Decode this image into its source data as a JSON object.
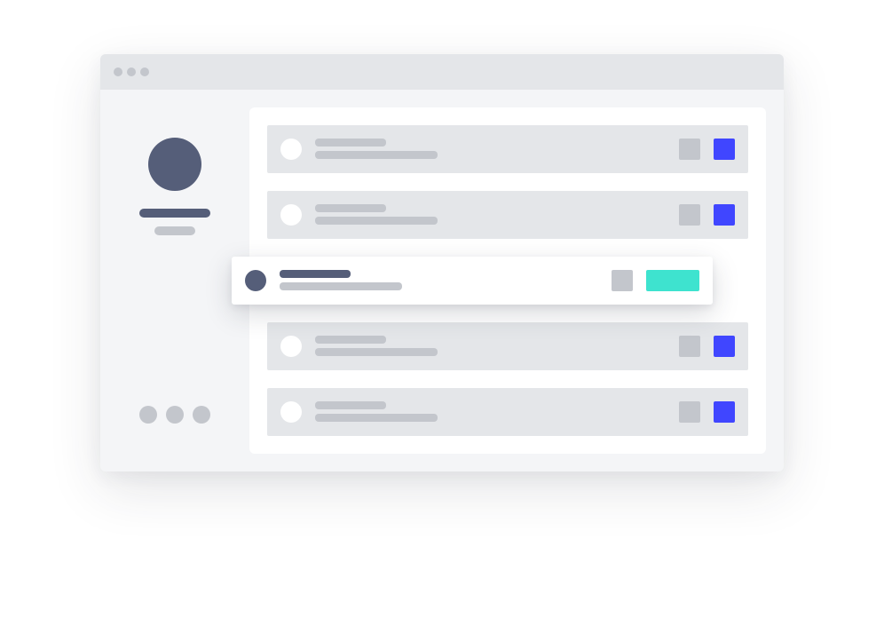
{
  "colors": {
    "background": "#ffffff",
    "window": "#f4f5f7",
    "titlebar": "#e4e6e9",
    "panel": "#ffffff",
    "row": "#e4e6e9",
    "placeholder": "#c3c6cc",
    "dark": "#555e79",
    "primary_button": "#4046ff",
    "accent_button": "#3ee3cf"
  },
  "window": {
    "titlebar_controls": [
      "window-dot-icon",
      "window-dot-icon",
      "window-dot-icon"
    ]
  },
  "sidebar": {
    "avatar": "avatar-placeholder",
    "footer_dots": [
      "dot-icon",
      "dot-icon",
      "dot-icon"
    ]
  },
  "list": {
    "rows": [
      {
        "state": "idle"
      },
      {
        "state": "idle"
      },
      {
        "state": "dragging"
      },
      {
        "state": "idle"
      },
      {
        "state": "idle"
      }
    ]
  }
}
